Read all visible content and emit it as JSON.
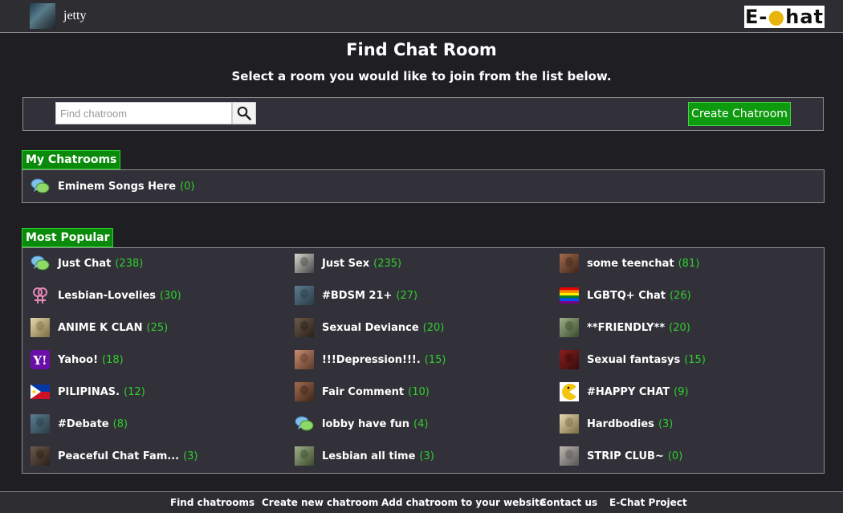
{
  "header": {
    "username": "jetty",
    "logo_text_left": "E-",
    "logo_text_right": "hat"
  },
  "page": {
    "title": "Find Chat Room",
    "subtitle": "Select a room you would like to join from the list below."
  },
  "search": {
    "placeholder": "Find chatroom",
    "value": ""
  },
  "toolbar": {
    "create_label": "Create Chatroom"
  },
  "my_chatrooms": {
    "label": "My Chatrooms",
    "rooms": [
      {
        "name": "Eminem Songs Here",
        "count": "(0)",
        "icon": "chat-bubbles-icon"
      }
    ]
  },
  "popular": {
    "label": "Most Popular",
    "rooms": [
      {
        "name": "Just Chat",
        "count": "(238)",
        "icon": "chat-bubbles-icon"
      },
      {
        "name": "Just Sex",
        "count": "(235)",
        "icon": "photo-thumb-icon"
      },
      {
        "name": "some teenchat",
        "count": "(81)",
        "icon": "photo-thumb-icon"
      },
      {
        "name": "Lesbian-Lovelies",
        "count": "(30)",
        "icon": "double-female-icon"
      },
      {
        "name": "#BDSM 21+",
        "count": "(27)",
        "icon": "photo-thumb-icon"
      },
      {
        "name": "LGBTQ+ Chat",
        "count": "(26)",
        "icon": "rainbow-flag-icon"
      },
      {
        "name": "ANIME K CLAN",
        "count": "(25)",
        "icon": "photo-thumb-icon"
      },
      {
        "name": "Sexual Deviance",
        "count": "(20)",
        "icon": "photo-thumb-icon"
      },
      {
        "name": "**FRIENDLY**",
        "count": "(20)",
        "icon": "photo-thumb-icon"
      },
      {
        "name": "Yahoo!",
        "count": "(18)",
        "icon": "yahoo-logo-icon"
      },
      {
        "name": "!!!Depression!!!.",
        "count": "(15)",
        "icon": "photo-thumb-icon"
      },
      {
        "name": "Sexual fantasys",
        "count": "(15)",
        "icon": "photo-thumb-icon"
      },
      {
        "name": "PILIPINAS.",
        "count": "(12)",
        "icon": "philippines-flag-icon"
      },
      {
        "name": "Fair Comment",
        "count": "(10)",
        "icon": "photo-thumb-icon"
      },
      {
        "name": "#HAPPY CHAT",
        "count": "(9)",
        "icon": "pacman-icon"
      },
      {
        "name": "#Debate",
        "count": "(8)",
        "icon": "photo-thumb-icon"
      },
      {
        "name": "lobby have fun",
        "count": "(4)",
        "icon": "chat-bubbles-icon"
      },
      {
        "name": "Hardbodies",
        "count": "(3)",
        "icon": "photo-thumb-icon"
      },
      {
        "name": "Peaceful Chat Fam...",
        "count": "(3)",
        "icon": "photo-thumb-icon"
      },
      {
        "name": "Lesbian all time",
        "count": "(3)",
        "icon": "photo-thumb-icon"
      },
      {
        "name": "STRIP CLUB~",
        "count": "(0)",
        "icon": "photo-thumb-icon"
      }
    ]
  },
  "footer": {
    "links": [
      "Find chatrooms",
      "Create new chatroom",
      "Add chatroom to your website",
      "Contact us",
      "E-Chat Project"
    ]
  },
  "colors": {
    "accent_green": "#0e9a0e",
    "count_green": "#2fcf2f",
    "background": "#1f1e22",
    "panel": "#323139"
  }
}
